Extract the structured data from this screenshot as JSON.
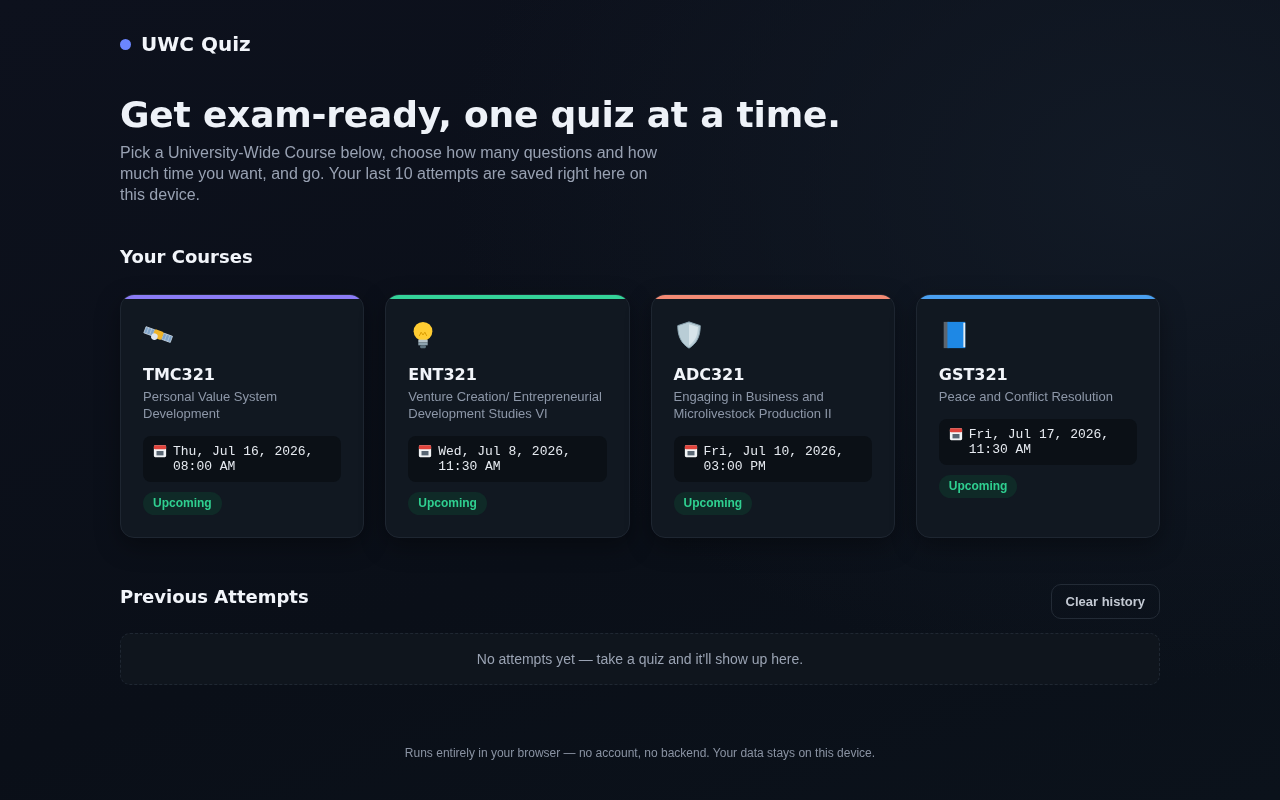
{
  "brand": {
    "name": "UWC Quiz"
  },
  "hero": {
    "title": "Get exam-ready, one quiz at a time.",
    "subtitle": "Pick a University-Wide Course below, choose how many questions and how much time you want, and go. Your last 10 attempts are saved right here on this device."
  },
  "courses": {
    "heading": "Your Courses",
    "items": [
      {
        "code": "TMC321",
        "title": "Personal Value System Development",
        "date": "Thu, Jul 16, 2026, 08:00 AM",
        "status": "Upcoming",
        "color": "#8b7cf6"
      },
      {
        "code": "ENT321",
        "title": "Venture Creation/ Entrepreneurial Development Studies VI",
        "date": "Wed, Jul 8, 2026, 11:30 AM",
        "status": "Upcoming",
        "color": "#34d399"
      },
      {
        "code": "ADC321",
        "title": "Engaging in Business and Microlivestock Production II",
        "date": "Fri, Jul 10, 2026, 03:00 PM",
        "status": "Upcoming",
        "color": "#f38a74"
      },
      {
        "code": "GST321",
        "title": "Peace and Conflict Resolution",
        "date": "Fri, Jul 17, 2026, 11:30 AM",
        "status": "Upcoming",
        "color": "#4a9ff0"
      }
    ]
  },
  "attempts": {
    "heading": "Previous Attempts",
    "clear_button": "Clear history",
    "empty_message": "No attempts yet — take a quiz and it'll show up here."
  },
  "footer": "Runs entirely in your browser — no account, no backend. Your data stays on this device."
}
